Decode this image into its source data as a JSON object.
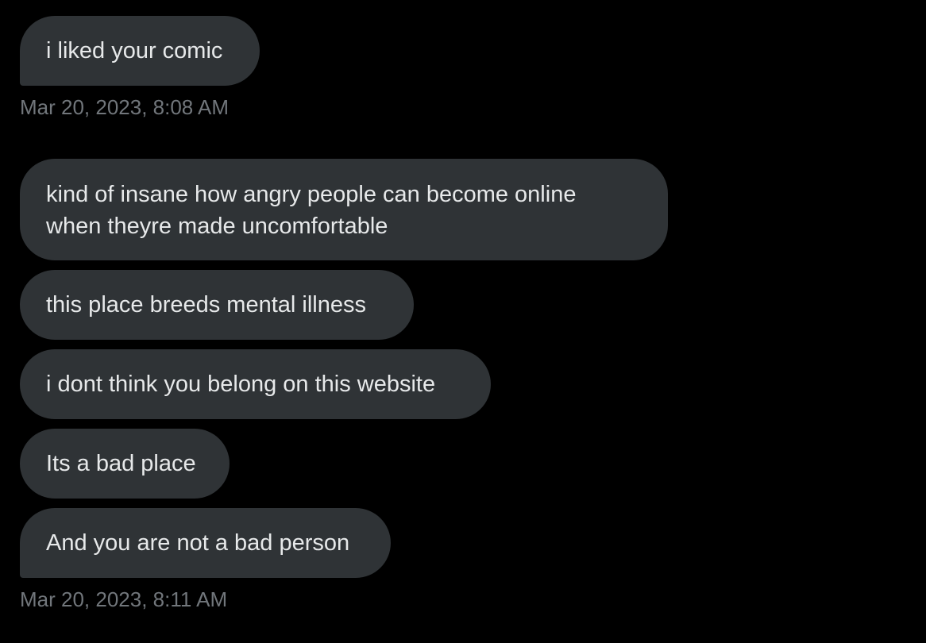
{
  "conversation": {
    "groups": [
      {
        "messages": [
          {
            "lines": [
              "i liked your comic"
            ]
          }
        ],
        "timestamp": "Mar 20, 2023, 8:08 AM"
      },
      {
        "messages": [
          {
            "lines": [
              "kind of insane how angry people can become online",
              "when theyre made uncomfortable"
            ]
          },
          {
            "lines": [
              "this place breeds mental illness"
            ]
          },
          {
            "lines": [
              "i dont think you belong on this website"
            ]
          },
          {
            "lines": [
              "Its a bad place"
            ]
          },
          {
            "lines": [
              "And you are not a bad person"
            ]
          }
        ],
        "timestamp": "Mar 20, 2023, 8:11 AM"
      }
    ]
  },
  "colors": {
    "background": "#000000",
    "bubble": "#2f3336",
    "text": "#e7e9ea",
    "timestamp": "#71767b"
  }
}
